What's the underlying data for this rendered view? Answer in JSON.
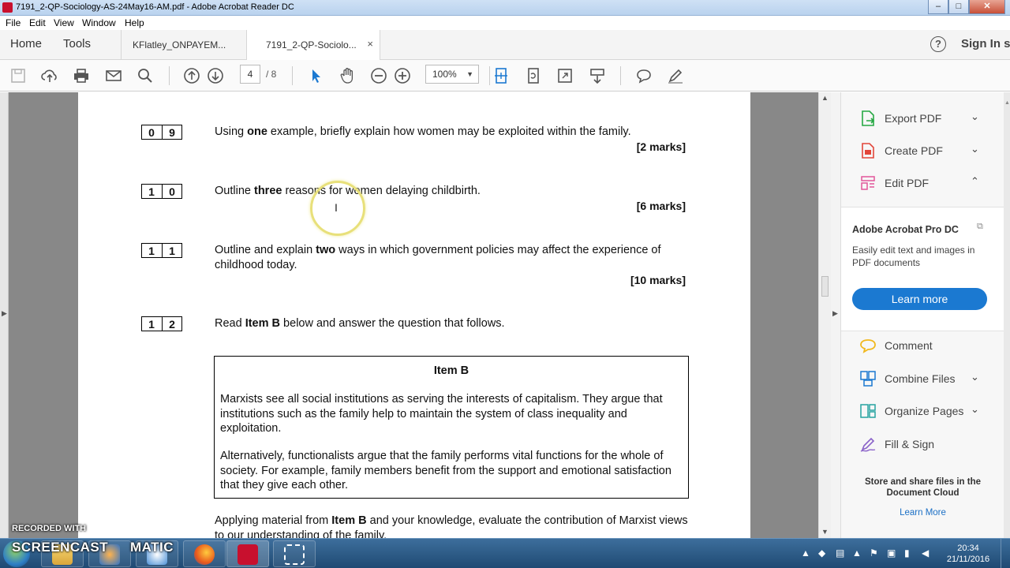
{
  "window": {
    "title": "7191_2-QP-Sociology-AS-24May16-AM.pdf - Adobe Acrobat Reader DC",
    "minimize": "–",
    "maximize": "□",
    "close": "✕"
  },
  "menu": [
    "File",
    "Edit",
    "View",
    "Window",
    "Help"
  ],
  "tabs": {
    "home": "Home",
    "tools": "Tools",
    "documents": [
      {
        "label": "KFlatley_ONPAYEM..."
      },
      {
        "label": "7191_2-QP-Sociolo...",
        "close": "×"
      }
    ],
    "help": "?",
    "sign_in": "Sign In s"
  },
  "toolbar": {
    "page_current": "4",
    "page_total": "/ 8",
    "zoom": "100%"
  },
  "document": {
    "questions": [
      {
        "d1": "0",
        "d2": "9",
        "pre": "Using ",
        "bold": "one",
        "post": " example, briefly explain how women may be exploited within the family.",
        "marks": "[2 marks]"
      },
      {
        "d1": "1",
        "d2": "0",
        "pre": "Outline ",
        "bold": "three",
        "post": " reasons for women delaying childbirth.",
        "marks": "[6 marks]"
      },
      {
        "d1": "1",
        "d2": "1",
        "pre": "Outline and explain ",
        "bold": "two",
        "post": " ways in which government policies may affect the experience of childhood today.",
        "marks": "[10 marks]"
      },
      {
        "d1": "1",
        "d2": "2",
        "pre": "Read ",
        "bold": "Item B",
        "post": " below and answer the question that follows.",
        "marks": ""
      }
    ],
    "item_b": {
      "title": "Item B",
      "para1": "Marxists see all social institutions as serving the interests of capitalism.  They argue that institutions such as the family help to maintain the system of class inequality and exploitation.",
      "para2": "Alternatively, functionalists argue that the family performs vital functions for the whole of society.  For example, family members benefit from the support and emotional satisfaction that they give each other."
    },
    "final": {
      "pre": "Applying material from ",
      "bold": "Item B",
      "post": " and your knowledge, evaluate the contribution of Marxist views to our understanding of the family."
    }
  },
  "right_pane": {
    "tools": [
      {
        "label": "Export PDF",
        "chevron": "⌄",
        "icon": "export-pdf-icon",
        "color": "#27a844"
      },
      {
        "label": "Create PDF",
        "chevron": "⌄",
        "icon": "create-pdf-icon",
        "color": "#e2463a"
      },
      {
        "label": "Edit PDF",
        "chevron": "⌃",
        "icon": "edit-pdf-icon",
        "color": "#e2579a"
      }
    ],
    "promo": {
      "heading": "Adobe Acrobat Pro DC",
      "body": "Easily edit text and images in PDF documents",
      "button": "Learn more"
    },
    "tools2": [
      {
        "label": "Comment",
        "chevron": "",
        "icon": "comment-icon",
        "color": "#f1b81d"
      },
      {
        "label": "Combine Files",
        "chevron": "⌄",
        "icon": "combine-files-icon",
        "color": "#1b79d1"
      },
      {
        "label": "Organize Pages",
        "chevron": "⌄",
        "icon": "organize-pages-icon",
        "color": "#27a3a0"
      },
      {
        "label": "Fill & Sign",
        "chevron": "",
        "icon": "fill-sign-icon",
        "color": "#8a62c9"
      }
    ],
    "store": {
      "heading": "Store and share files in the Document Cloud",
      "link": "Learn More"
    }
  },
  "taskbar": {
    "time": "20:34",
    "date": "21/11/2016"
  },
  "watermark": {
    "line1": "RECORDED WITH",
    "line2": "SCREENCAST",
    "line3": "MATIC"
  }
}
